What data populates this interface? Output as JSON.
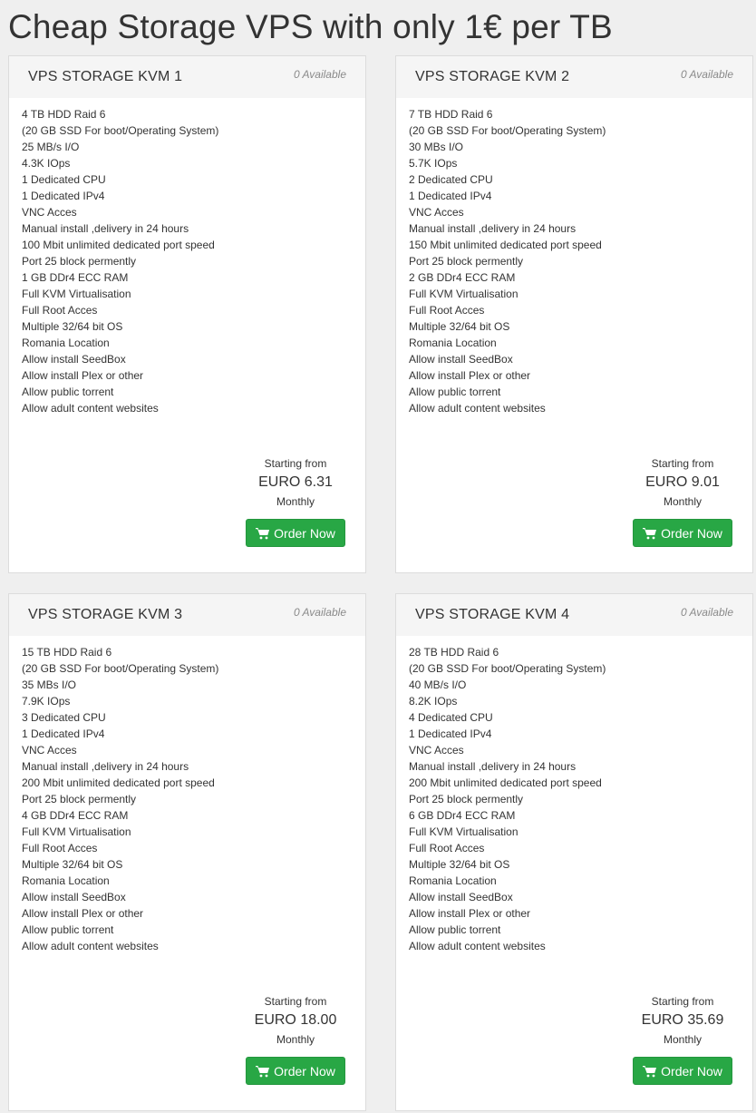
{
  "page": {
    "title": "Cheap Storage VPS with only 1€ per TB"
  },
  "colors": {
    "button": "#28a745",
    "header_bg": "#f5f5f5",
    "page_bg": "#efefef"
  },
  "products": [
    {
      "name": "VPS STORAGE KVM 1",
      "availability": "0 Available",
      "features": [
        "4 TB HDD Raid 6",
        "(20 GB SSD For boot/Operating System)",
        "25 MB/s I/O",
        "4.3K IOps",
        "1 Dedicated CPU",
        "1 Dedicated IPv4",
        "VNC Acces",
        "Manual install ,delivery in 24 hours",
        "100 Mbit unlimited dedicated port speed",
        "Port 25 block permently",
        "1 GB DDr4 ECC RAM",
        "Full KVM Virtualisation",
        "Full Root Acces",
        "Multiple 32/64 bit OS",
        "Romania Location",
        "Allow install SeedBox",
        "Allow install Plex or other",
        "Allow public torrent",
        "Allow adult content websites"
      ],
      "price_label": "Starting from",
      "price": "EURO 6.31",
      "billing_cycle": "Monthly",
      "button_label": "Order Now",
      "button_icon": "shopping-cart-icon"
    },
    {
      "name": "VPS STORAGE KVM 2",
      "availability": "0 Available",
      "features": [
        "7 TB HDD Raid 6",
        "(20 GB SSD For boot/Operating System)",
        "30 MBs I/O",
        "5.7K IOps",
        "2 Dedicated CPU",
        "1 Dedicated IPv4",
        "VNC Acces",
        "Manual install ,delivery in 24 hours",
        "150 Mbit unlimited dedicated port speed",
        "Port 25 block permently",
        "2 GB DDr4 ECC RAM",
        "Full KVM Virtualisation",
        "Full Root Acces",
        "Multiple 32/64 bit OS",
        "Romania Location",
        "Allow install SeedBox",
        "Allow install Plex or other",
        "Allow public torrent",
        "Allow adult content websites"
      ],
      "price_label": "Starting from",
      "price": "EURO 9.01",
      "billing_cycle": "Monthly",
      "button_label": "Order Now",
      "button_icon": "shopping-cart-icon"
    },
    {
      "name": "VPS STORAGE KVM 3",
      "availability": "0 Available",
      "features": [
        "15 TB HDD Raid 6",
        "(20 GB SSD For boot/Operating System)",
        "35 MBs I/O",
        "7.9K IOps",
        "3 Dedicated CPU",
        "1 Dedicated IPv4",
        "VNC Acces",
        "Manual install ,delivery in 24 hours",
        "200 Mbit unlimited dedicated port speed",
        "Port 25 block permently",
        "4 GB DDr4 ECC RAM",
        "Full KVM Virtualisation",
        "Full Root Acces",
        "Multiple 32/64 bit OS",
        "Romania Location",
        "Allow install SeedBox",
        "Allow install Plex or other",
        "Allow public torrent",
        "Allow adult content websites"
      ],
      "price_label": "Starting from",
      "price": "EURO 18.00",
      "billing_cycle": "Monthly",
      "button_label": "Order Now",
      "button_icon": "shopping-cart-icon"
    },
    {
      "name": "VPS STORAGE KVM 4",
      "availability": "0 Available",
      "features": [
        "28 TB HDD Raid 6",
        "(20 GB SSD For boot/Operating System)",
        "40 MB/s I/O",
        "8.2K IOps",
        "4 Dedicated CPU",
        "1 Dedicated IPv4",
        "VNC Acces",
        "Manual install ,delivery in 24 hours",
        "200 Mbit unlimited dedicated port speed",
        "Port 25 block permently",
        "6 GB DDr4 ECC RAM",
        "Full KVM Virtualisation",
        "Full Root Acces",
        "Multiple 32/64 bit OS",
        "Romania Location",
        "Allow install SeedBox",
        "Allow install Plex or other",
        "Allow public torrent",
        "Allow adult content websites"
      ],
      "price_label": "Starting from",
      "price": "EURO 35.69",
      "billing_cycle": "Monthly",
      "button_label": "Order Now",
      "button_icon": "shopping-cart-icon"
    }
  ]
}
